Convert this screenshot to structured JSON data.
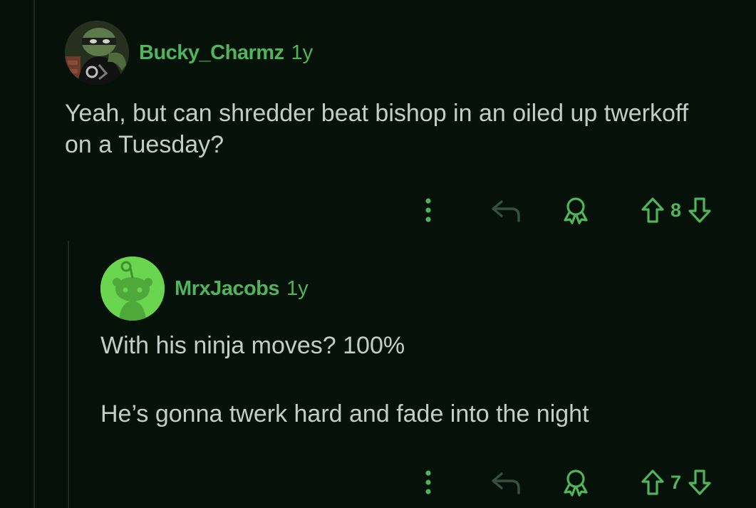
{
  "colors": {
    "background": "#061109",
    "accent": "#4fb45a",
    "text": "#c3cdc9",
    "thread_line": "#1f2a24"
  },
  "comments": [
    {
      "username": "Bucky_Charmz",
      "age": "1y",
      "avatar": "character-avatar",
      "body": "Yeah, but can shredder beat bishop in an oiled up twerkoff on a Tuesday?",
      "score": "8"
    },
    {
      "username": "MrxJacobs",
      "age": "1y",
      "avatar": "default-snoo-avatar",
      "body": [
        "With his ninja moves? 100%",
        "He’s gonna twerk hard and fade into the night"
      ],
      "score": "7"
    }
  ],
  "icons": {
    "more": "more-vertical-icon",
    "reply": "reply-arrow-icon",
    "award": "award-icon",
    "upvote": "upvote-arrow-icon",
    "downvote": "downvote-arrow-icon"
  }
}
